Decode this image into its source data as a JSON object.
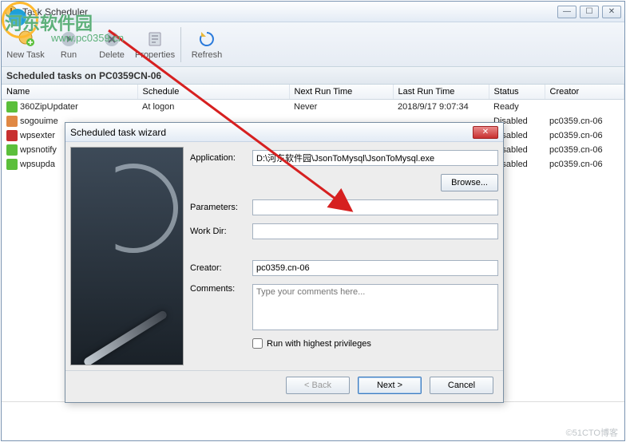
{
  "window": {
    "title": "Task Scheduler"
  },
  "toolbar": {
    "new_task": "New Task",
    "run": "Run",
    "delete": "Delete",
    "properties": "Properties",
    "refresh": "Refresh"
  },
  "section_header": "Scheduled tasks on PC0359CN-06",
  "columns": {
    "name": "Name",
    "schedule": "Schedule",
    "next_run": "Next Run Time",
    "last_run": "Last Run Time",
    "status": "Status",
    "creator": "Creator"
  },
  "tasks": [
    {
      "icon": "#5bbf3b",
      "name": "360ZipUpdater",
      "schedule": "At logon",
      "next": "Never",
      "last": "2018/9/17 9:07:34",
      "status": "Ready",
      "creator": ""
    },
    {
      "icon": "#e08844",
      "name": "sogouime",
      "schedule": "",
      "next": "",
      "last": "",
      "status": "Disabled",
      "creator": "pc0359.cn-06"
    },
    {
      "icon": "#c83030",
      "name": "wpsexter",
      "schedule": "",
      "next": "",
      "last": "",
      "status": "Disabled",
      "creator": "pc0359.cn-06"
    },
    {
      "icon": "#5bbf3b",
      "name": "wpsnotify",
      "schedule": "",
      "next": "",
      "last": "",
      "status": "Disabled",
      "creator": "pc0359.cn-06"
    },
    {
      "icon": "#5bbf3b",
      "name": "wpsupda",
      "schedule": "",
      "next": "",
      "last": "",
      "status": "Disabled",
      "creator": "pc0359.cn-06"
    }
  ],
  "dialog": {
    "title": "Scheduled task wizard",
    "labels": {
      "application": "Application:",
      "parameters": "Parameters:",
      "work_dir": "Work Dir:",
      "creator": "Creator:",
      "comments": "Comments:",
      "browse": "Browse...",
      "privileges": "Run with highest privileges",
      "back": "< Back",
      "next": "Next >",
      "cancel": "Cancel"
    },
    "values": {
      "application": "D:\\河东软件园\\JsonToMysql\\JsonToMysql.exe",
      "parameters": "",
      "work_dir": "",
      "creator": "pc0359.cn-06",
      "comments_placeholder": "Type your comments here..."
    }
  },
  "watermark": {
    "main": "河东软件园",
    "url": "www.pc0359.cn"
  },
  "footer_watermark": "©51CTO博客"
}
